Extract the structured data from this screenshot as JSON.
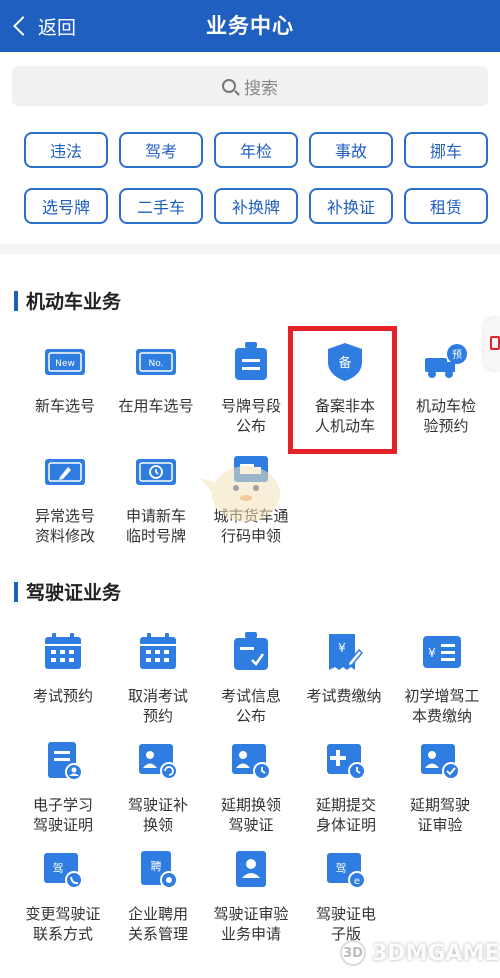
{
  "header": {
    "back_label": "返回",
    "title": "业务中心"
  },
  "search": {
    "placeholder": "搜索"
  },
  "quick_tags": [
    "违法",
    "驾考",
    "年检",
    "事故",
    "挪车",
    "选号牌",
    "二手车",
    "补换牌",
    "补换证",
    "租赁"
  ],
  "sections": [
    {
      "title": "机动车业务",
      "items": [
        {
          "label": "新车选号",
          "icon": "new-plate-icon"
        },
        {
          "label": "在用车选号",
          "icon": "no-plate-icon"
        },
        {
          "label": "号牌号段\n公布",
          "icon": "plate-announce-icon"
        },
        {
          "label": "备案非本\n人机动车",
          "icon": "shield-bei-icon"
        },
        {
          "label": "机动车检\n验预约",
          "icon": "truck-appointment-icon"
        },
        {
          "label": "异常选号\n资料修改",
          "icon": "edit-plate-icon"
        },
        {
          "label": "申请新车\n临时号牌",
          "icon": "temp-plate-icon"
        },
        {
          "label": "城市货车通\n行码申领",
          "icon": "truck-pass-icon"
        }
      ]
    },
    {
      "title": "驾驶证业务",
      "items": [
        {
          "label": "考试预约",
          "icon": "calendar-icon"
        },
        {
          "label": "取消考试\n预约",
          "icon": "calendar-cancel-icon"
        },
        {
          "label": "考试信息\n公布",
          "icon": "exam-info-icon"
        },
        {
          "label": "考试费缴纳",
          "icon": "fee-receipt-icon"
        },
        {
          "label": "初学增驾工\n本费缴纳",
          "icon": "yen-list-icon"
        },
        {
          "label": "电子学习\n驾驶证明",
          "icon": "e-certificate-icon"
        },
        {
          "label": "驾驶证补\n换领",
          "icon": "license-renew-icon"
        },
        {
          "label": "延期换领\n驾驶证",
          "icon": "license-delay-icon"
        },
        {
          "label": "延期提交\n身体证明",
          "icon": "health-delay-icon"
        },
        {
          "label": "延期驾驶\n证审验",
          "icon": "license-check-icon"
        },
        {
          "label": "变更驾驶证\n联系方式",
          "icon": "contact-change-icon"
        },
        {
          "label": "企业聘用\n关系管理",
          "icon": "employ-manage-icon"
        },
        {
          "label": "驾驶证审验\n业务申请",
          "icon": "review-apply-icon"
        },
        {
          "label": "驾驶证电\n子版",
          "icon": "e-license-icon"
        }
      ]
    }
  ],
  "watermark": {
    "text": "3DMGAME"
  },
  "colors": {
    "brand": "#1f5fc0",
    "icon_blue": "#2f7de1",
    "highlight": "#e5212a"
  }
}
